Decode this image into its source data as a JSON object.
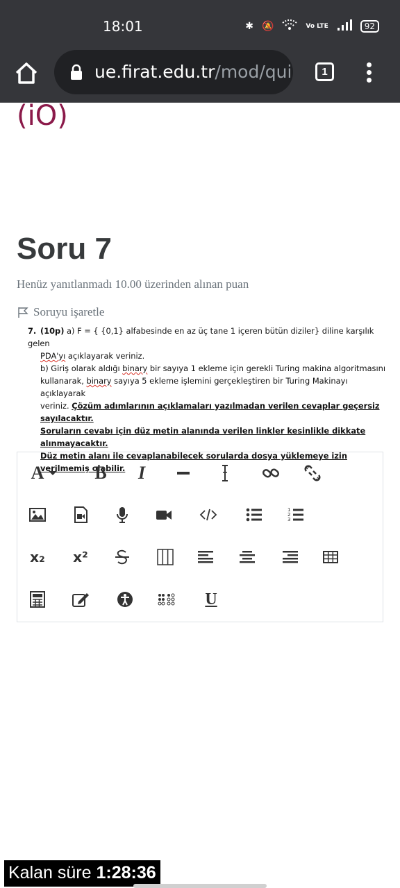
{
  "status_bar": {
    "time": "18:01",
    "battery": "92",
    "volte": "Vo LTE"
  },
  "browser": {
    "url_domain": "ue.firat.edu.tr",
    "url_path": "/mod/quiz/",
    "tab_count": "1"
  },
  "page": {
    "logo_fragment": "(iO)",
    "question_title": "Soru 7",
    "question_status": "Henüz yanıtlanmadı  10.00 üzerinden alınan puan",
    "flag_label": "Soruyu işaretle"
  },
  "question": {
    "number": "7.",
    "points": "(10p)",
    "part_a_1": " a) F = { {0,1} alfabesinde en az üç tane 1 içeren bütün diziler} diline karşılık gelen",
    "part_a_2_spell": "PDA'yı",
    "part_a_2_rest": " açıklayarak veriniz.",
    "part_b_1a": "b) Giriş olarak aldığı ",
    "part_b_1_spell": "binary",
    "part_b_1b": " bir sayıya 1 ekleme için gerekli Turing makina algoritmasını",
    "part_b_2a": "kullanarak, ",
    "part_b_2_spell": "binary",
    "part_b_2b": " sayıya 5 ekleme işlemini gerçekleştiren bir Turing Makinayı açıklayarak",
    "part_b_3a": "veriniz. ",
    "warning_1": "Çözüm adımlarının açıklamaları yazılmadan verilen cevaplar geçersiz sayılacaktır.",
    "warning_2": "Soruların cevabı için düz metin alanında verilen linkler kesinlikle dikkate alınmayacaktır.",
    "warning_3": "Düz metin alanı ile cevaplanabilecek sorularda dosya yüklemeye izin verilmemiş olabilir."
  },
  "editor": {
    "font_label": "A",
    "bold_label": "B",
    "italic_label": "I",
    "underline_label": "U",
    "subscript_label": "x₂",
    "superscript_label": "x²"
  },
  "timer": {
    "label": "Kalan süre ",
    "value": "1:28:36"
  },
  "colors": {
    "chrome_bg": "#35363a",
    "url_pill_bg": "#202124",
    "brand": "#8b1a4a",
    "muted_text": "#6a737b"
  }
}
